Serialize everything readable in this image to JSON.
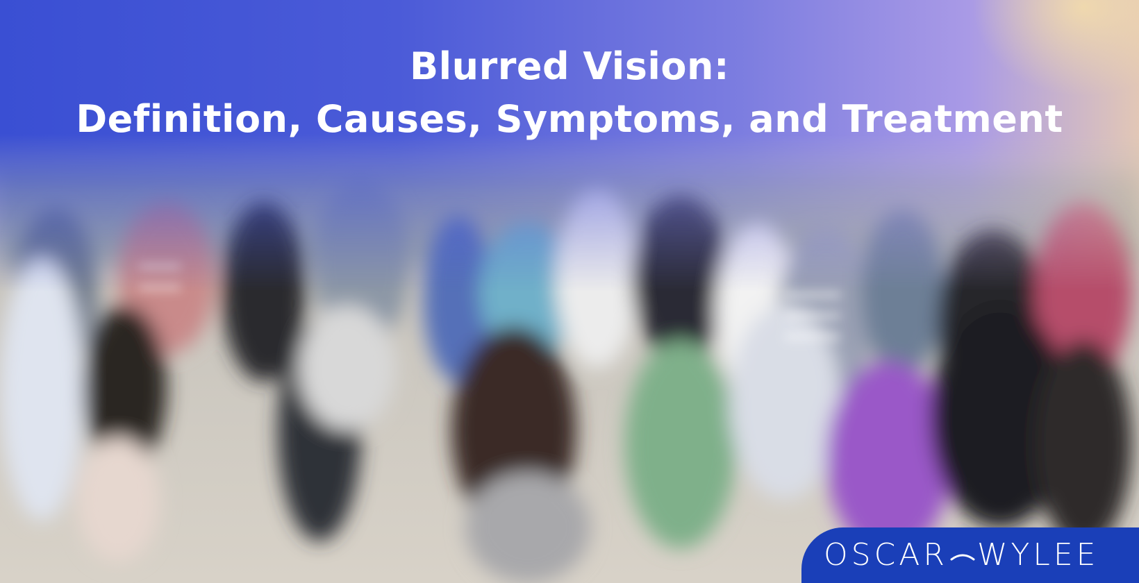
{
  "title": {
    "line1": "Blurred Vision:",
    "line2": "Definition, Causes, Symptoms, and Treatment"
  },
  "logo": {
    "part1": "OSCAR",
    "part2": "WYLEE"
  },
  "colors": {
    "overlay_left": "#3a4fd3",
    "overlay_right": "#a99ae6",
    "logo_bg": "#1a3fb8",
    "text": "#ffffff"
  }
}
